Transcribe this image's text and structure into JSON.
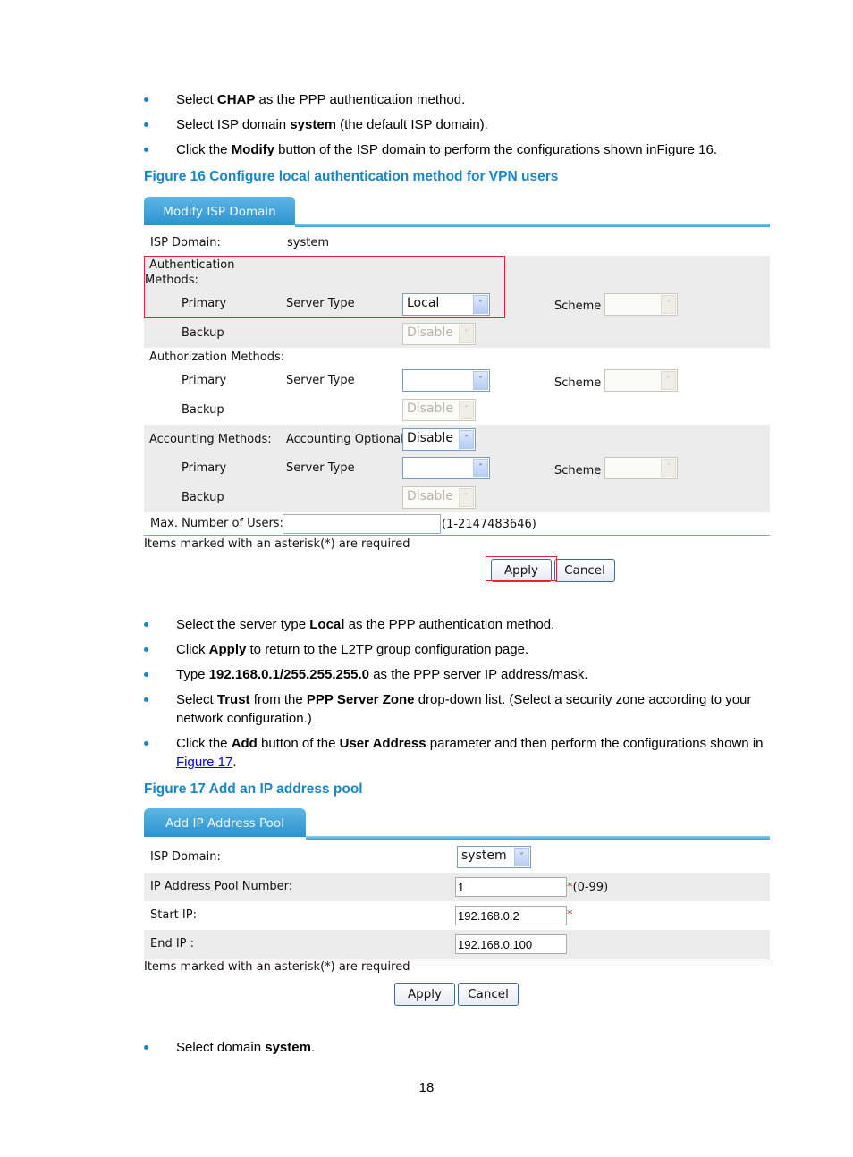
{
  "bullets_top": [
    {
      "parts": [
        {
          "t": "Select "
        },
        {
          "t": "CHAP",
          "b": true
        },
        {
          "t": " as the PPP authentication method."
        }
      ]
    },
    {
      "parts": [
        {
          "t": "Select ISP domain "
        },
        {
          "t": "system",
          "b": true
        },
        {
          "t": " (the default ISP domain)."
        }
      ]
    },
    {
      "parts": [
        {
          "t": "Click the "
        },
        {
          "t": "Modify",
          "b": true
        },
        {
          "t": " button of the ISP domain to perform the configurations shown inFigure 16."
        }
      ]
    }
  ],
  "figure16": {
    "caption": "Figure 16 Configure local authentication method for VPN users",
    "tab_label": "Modify ISP Domain",
    "isp_domain_label": "ISP Domain:",
    "isp_domain_value": "system",
    "authentication": {
      "label_line1": "Authentication",
      "label_line2": "Methods:",
      "primary_label": "Primary",
      "server_type_label": "Server Type",
      "primary_value": "Local",
      "scheme_label": "Scheme",
      "scheme_value": "",
      "backup_label": "Backup",
      "backup_value": "Disable"
    },
    "authorization": {
      "label": "Authorization Methods:",
      "primary_label": "Primary",
      "server_type_label": "Server Type",
      "primary_value": "",
      "scheme_label": "Scheme",
      "scheme_value": "",
      "backup_label": "Backup",
      "backup_value": "Disable"
    },
    "accounting": {
      "label": "Accounting Methods:",
      "optional_label": "Accounting Optional",
      "optional_value": "Disable",
      "primary_label": "Primary",
      "server_type_label": "Server Type",
      "primary_value": "",
      "scheme_label": "Scheme",
      "scheme_value": "",
      "backup_label": "Backup",
      "backup_value": "Disable"
    },
    "max_users_label": "Max. Number of Users:",
    "max_users_value": "",
    "max_users_range": "(1-2147483646)",
    "required_note": "Items marked with an asterisk(*) are required",
    "apply_label": "Apply",
    "cancel_label": "Cancel"
  },
  "bullets_mid": [
    {
      "parts": [
        {
          "t": "Select the server type "
        },
        {
          "t": "Local",
          "b": true
        },
        {
          "t": " as the PPP authentication method."
        }
      ]
    },
    {
      "parts": [
        {
          "t": "Click "
        },
        {
          "t": "Apply",
          "b": true
        },
        {
          "t": " to return to the L2TP group configuration page."
        }
      ]
    },
    {
      "parts": [
        {
          "t": "Type "
        },
        {
          "t": "192.168.0.1/255.255.255.0",
          "b": true
        },
        {
          "t": " as the PPP server IP address/mask."
        }
      ]
    },
    {
      "parts": [
        {
          "t": "Select "
        },
        {
          "t": "Trust",
          "b": true
        },
        {
          "t": " from the "
        },
        {
          "t": "PPP Server Zone",
          "b": true
        },
        {
          "t": " drop-down list. (Select a security zone according to your network configuration.)"
        }
      ]
    },
    {
      "parts": [
        {
          "t": "Click the "
        },
        {
          "t": "Add",
          "b": true
        },
        {
          "t": " button of the "
        },
        {
          "t": "User Address",
          "b": true
        },
        {
          "t": " parameter and then perform the configurations shown in "
        },
        {
          "t": "Figure 17",
          "link": true
        },
        {
          "t": "."
        }
      ]
    }
  ],
  "figure17": {
    "caption": "Figure 17 Add an IP address pool",
    "tab_label": "Add IP Address Pool",
    "isp_domain_label": "ISP Domain:",
    "isp_domain_value": "system",
    "pool_number_label": "IP Address Pool Number:",
    "pool_number_value": "1",
    "pool_number_hint": "(0-99)",
    "start_ip_label": "Start IP:",
    "start_ip_value": "192.168.0.2",
    "end_ip_label": "End IP :",
    "end_ip_value": "192.168.0.100",
    "asterisk": "*",
    "required_note": "Items marked with an asterisk(*) are required",
    "apply_label": "Apply",
    "cancel_label": "Cancel"
  },
  "bullets_bottom": [
    {
      "parts": [
        {
          "t": "Select domain "
        },
        {
          "t": "system",
          "b": true
        },
        {
          "t": "."
        }
      ]
    }
  ],
  "page_number": "18",
  "colors": {
    "accent": "#1a86c8",
    "highlight": "#e0262c",
    "row_gray": "#ececec"
  }
}
